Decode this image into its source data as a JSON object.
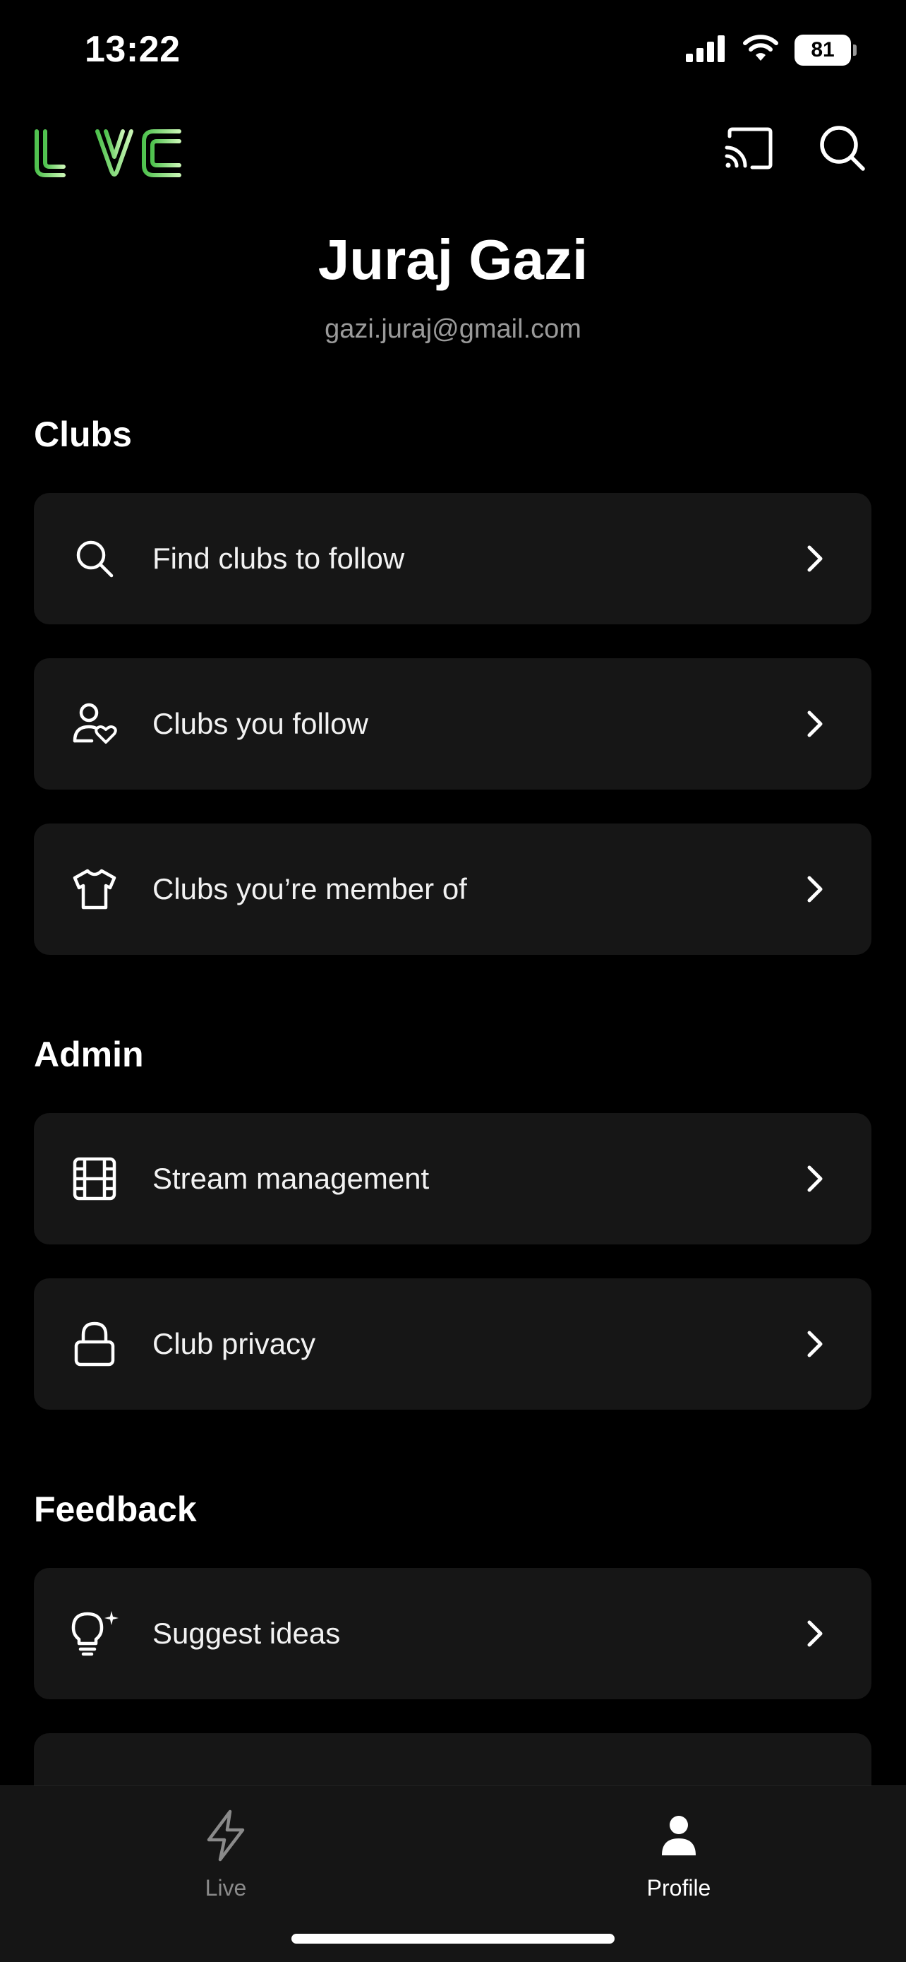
{
  "status_bar": {
    "time": "13:22",
    "battery": "81"
  },
  "header": {
    "logo_text": "LIVE",
    "logo_colors": [
      "#5fd05a",
      "#b9f0a8"
    ],
    "cast_icon": "cast-icon",
    "search_icon": "search-icon"
  },
  "profile": {
    "name": "Juraj Gazi",
    "email": "gazi.juraj@gmail.com"
  },
  "sections": {
    "clubs": {
      "title": "Clubs",
      "items": [
        {
          "label": "Find clubs to follow",
          "icon": "search-icon"
        },
        {
          "label": "Clubs you follow",
          "icon": "user-heart-icon"
        },
        {
          "label": "Clubs you’re member of",
          "icon": "shirt-icon"
        }
      ]
    },
    "admin": {
      "title": "Admin",
      "items": [
        {
          "label": "Stream management",
          "icon": "film-icon"
        },
        {
          "label": "Club privacy",
          "icon": "lock-icon"
        }
      ]
    },
    "feedback": {
      "title": "Feedback",
      "items": [
        {
          "label": "Suggest ideas",
          "icon": "lightbulb-sparkle-icon"
        }
      ]
    }
  },
  "bottom_nav": {
    "items": [
      {
        "label": "Live",
        "icon": "bolt-icon",
        "active": false
      },
      {
        "label": "Profile",
        "icon": "person-icon",
        "active": true
      }
    ]
  },
  "colors": {
    "background": "#000000",
    "card": "#161616",
    "accent_green": "#5fd05a",
    "muted_text": "#9a9a9a"
  }
}
